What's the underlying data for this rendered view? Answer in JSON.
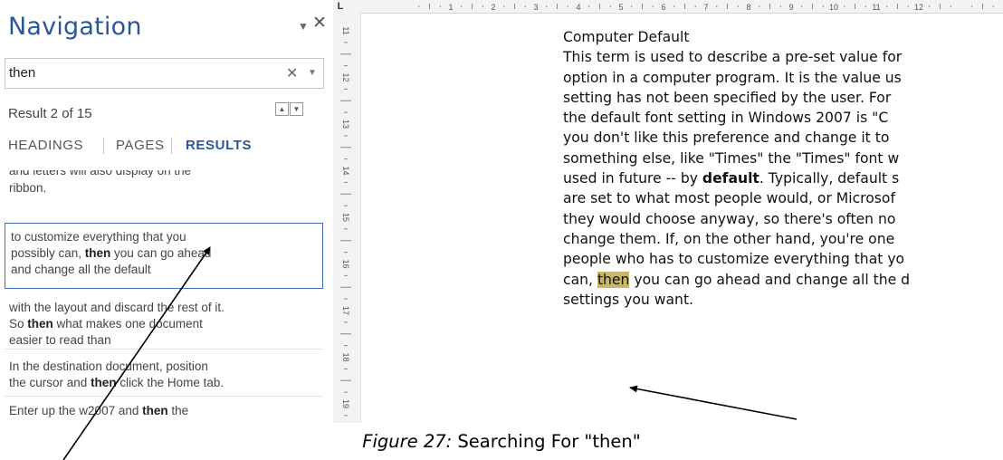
{
  "nav": {
    "title": "Navigation",
    "search_value": "then",
    "result_count": "Result 2 of 15",
    "tabs": [
      "HEADINGS",
      "PAGES",
      "RESULTS"
    ],
    "active_tab": "RESULTS",
    "results": [
      {
        "partial_line": "and letters will also display on the",
        "text": "ribbon."
      },
      {
        "lines": [
          {
            "before": "to customize everything that you",
            "bold": "",
            "after": ""
          },
          {
            "before": "possibly can, ",
            "bold": "then",
            "after": " you can go ahead"
          },
          {
            "before": "and change all the default",
            "bold": "",
            "after": ""
          }
        ]
      },
      {
        "lines": [
          {
            "before": "with the layout and discard the rest of it.",
            "bold": "",
            "after": ""
          },
          {
            "before": "So ",
            "bold": "then",
            "after": " what makes one document"
          },
          {
            "before": "easier to read than",
            "bold": "",
            "after": ""
          }
        ]
      },
      {
        "lines": [
          {
            "before": "In the destination document, position",
            "bold": "",
            "after": ""
          },
          {
            "before": "the cursor and ",
            "bold": "then",
            "after": " click the Home tab."
          }
        ]
      },
      {
        "lines": [
          {
            "before": "Enter up the w2007 and ",
            "bold": "then",
            "after": " the"
          }
        ]
      }
    ]
  },
  "ruler": {
    "corner": "L",
    "h_numbers": [
      "1",
      "2",
      "3",
      "4",
      "5",
      "6",
      "7",
      "8",
      "9",
      "10",
      "11",
      "12"
    ],
    "v_numbers": [
      "11",
      "12",
      "13",
      "14",
      "15",
      "16",
      "17",
      "18",
      "19"
    ]
  },
  "document": {
    "heading": "Computer Default",
    "lines": [
      "This term is used to describe a pre-set value for",
      "option in a computer program. It is the value us",
      "setting has not been specified by the user. For",
      "the default font setting in Windows 2007 is \"C",
      "you don't like this preference and change it to",
      "something else, like \"Times\" the \"Times\" font w",
      "used in future -- by ",
      "are set to what most people would, or Microsof",
      "they would choose anyway, so there's often no",
      "change them. If, on the other hand, you're one",
      "people who has to customize everything that yo",
      "can, ",
      "settings you want."
    ],
    "line7_bold": "default",
    "line7_after": ". Typically, default s",
    "line12_highlight": "then",
    "line12_after": " you can go ahead and change all the d",
    "highlight_color": "#c9b66d"
  },
  "caption": {
    "italic": "Figure 27:",
    "text": " Searching For \"then\""
  },
  "colors": {
    "accent": "#2b579a",
    "selected_border": "#3f6fb2"
  }
}
